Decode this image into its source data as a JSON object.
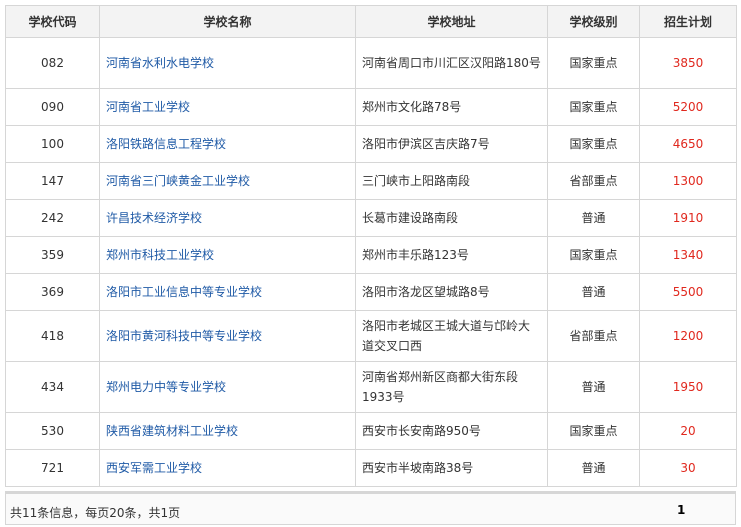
{
  "table": {
    "headers": [
      "学校代码",
      "学校名称",
      "学校地址",
      "学校级别",
      "招生计划"
    ],
    "rows": [
      {
        "code": "082",
        "name": "河南省水利水电学校",
        "address": "河南省周口市川汇区汉阳路180号",
        "level": "国家重点",
        "plan": "3850"
      },
      {
        "code": "090",
        "name": "河南省工业学校",
        "address": "郑州市文化路78号",
        "level": "国家重点",
        "plan": "5200"
      },
      {
        "code": "100",
        "name": "洛阳铁路信息工程学校",
        "address": "洛阳市伊滨区吉庆路7号",
        "level": "国家重点",
        "plan": "4650"
      },
      {
        "code": "147",
        "name": "河南省三门峡黄金工业学校",
        "address": "三门峡市上阳路南段",
        "level": "省部重点",
        "plan": "1300"
      },
      {
        "code": "242",
        "name": "许昌技术经济学校",
        "address": "长葛市建设路南段",
        "level": "普通",
        "plan": "1910"
      },
      {
        "code": "359",
        "name": "郑州市科技工业学校",
        "address": "郑州市丰乐路123号",
        "level": "国家重点",
        "plan": "1340"
      },
      {
        "code": "369",
        "name": "洛阳市工业信息中等专业学校",
        "address": "洛阳市洛龙区望城路8号",
        "level": "普通",
        "plan": "5500"
      },
      {
        "code": "418",
        "name": "洛阳市黄河科技中等专业学校",
        "address": "洛阳市老城区王城大道与邙岭大道交叉口西",
        "level": "省部重点",
        "plan": "1200"
      },
      {
        "code": "434",
        "name": "郑州电力中等专业学校",
        "address": "河南省郑州新区商都大街东段1933号",
        "level": "普通",
        "plan": "1950"
      },
      {
        "code": "530",
        "name": "陕西省建筑材料工业学校",
        "address": "西安市长安南路950号",
        "level": "国家重点",
        "plan": "20"
      },
      {
        "code": "721",
        "name": "西安军需工业学校",
        "address": "西安市半坡南路38号",
        "level": "普通",
        "plan": "30"
      }
    ]
  },
  "pager": {
    "summary": "共11条信息，每页20条，共1页",
    "current_page": "1"
  },
  "colors": {
    "link": "#1f5aa6",
    "plan": "#e0281e",
    "header_bg": "#f3f3f3",
    "border": "#d6d6d6"
  },
  "chart_data": {
    "type": "table",
    "columns": [
      "学校代码",
      "学校名称",
      "学校地址",
      "学校级别",
      "招生计划"
    ],
    "rows": [
      [
        "082",
        "河南省水利水电学校",
        "河南省周口市川汇区汉阳路180号",
        "国家重点",
        3850
      ],
      [
        "090",
        "河南省工业学校",
        "郑州市文化路78号",
        "国家重点",
        5200
      ],
      [
        "100",
        "洛阳铁路信息工程学校",
        "洛阳市伊滨区吉庆路7号",
        "国家重点",
        4650
      ],
      [
        "147",
        "河南省三门峡黄金工业学校",
        "三门峡市上阳路南段",
        "省部重点",
        1300
      ],
      [
        "242",
        "许昌技术经济学校",
        "长葛市建设路南段",
        "普通",
        1910
      ],
      [
        "359",
        "郑州市科技工业学校",
        "郑州市丰乐路123号",
        "国家重点",
        1340
      ],
      [
        "369",
        "洛阳市工业信息中等专业学校",
        "洛阳市洛龙区望城路8号",
        "普通",
        5500
      ],
      [
        "418",
        "洛阳市黄河科技中等专业学校",
        "洛阳市老城区王城大道与邙岭大道交叉口西",
        "省部重点",
        1200
      ],
      [
        "434",
        "郑州电力中等专业学校",
        "河南省郑州新区商都大街东段1933号",
        "普通",
        1950
      ],
      [
        "530",
        "陕西省建筑材料工业学校",
        "西安市长安南路950号",
        "国家重点",
        20
      ],
      [
        "721",
        "西安军需工业学校",
        "西安市半坡南路38号",
        "普通",
        30
      ]
    ]
  }
}
